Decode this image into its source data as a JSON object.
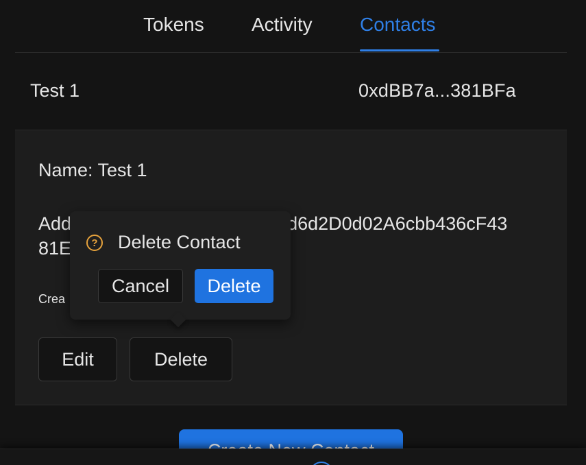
{
  "tabs": [
    {
      "label": "Tokens"
    },
    {
      "label": "Activity"
    },
    {
      "label": "Contacts",
      "active": true
    }
  ],
  "contact": {
    "name": "Test 1",
    "short_address": "0xdBB7a...381BFa"
  },
  "details": {
    "name_line": "Name: Test 1",
    "address_line": "Address: 0xdBB7a9d6d2D0d02A6cbb436cF4381BFa",
    "address_visible_prefix": "Add",
    "address_visible_suffix": "9d6d2D0d02A6cbb436cF43",
    "address_visible_line2": "81E",
    "created_visible": "Crea",
    "edit_label": "Edit",
    "delete_label": "Delete"
  },
  "popconfirm": {
    "icon": "question-circle-icon",
    "title": "Delete Contact",
    "cancel_label": "Cancel",
    "ok_label": "Delete"
  },
  "create_button": {
    "label": "Create New Contact"
  },
  "colors": {
    "accent": "#1f73e0",
    "warning": "#e6a23c",
    "background": "#141414",
    "panel": "#1d1d1d"
  }
}
